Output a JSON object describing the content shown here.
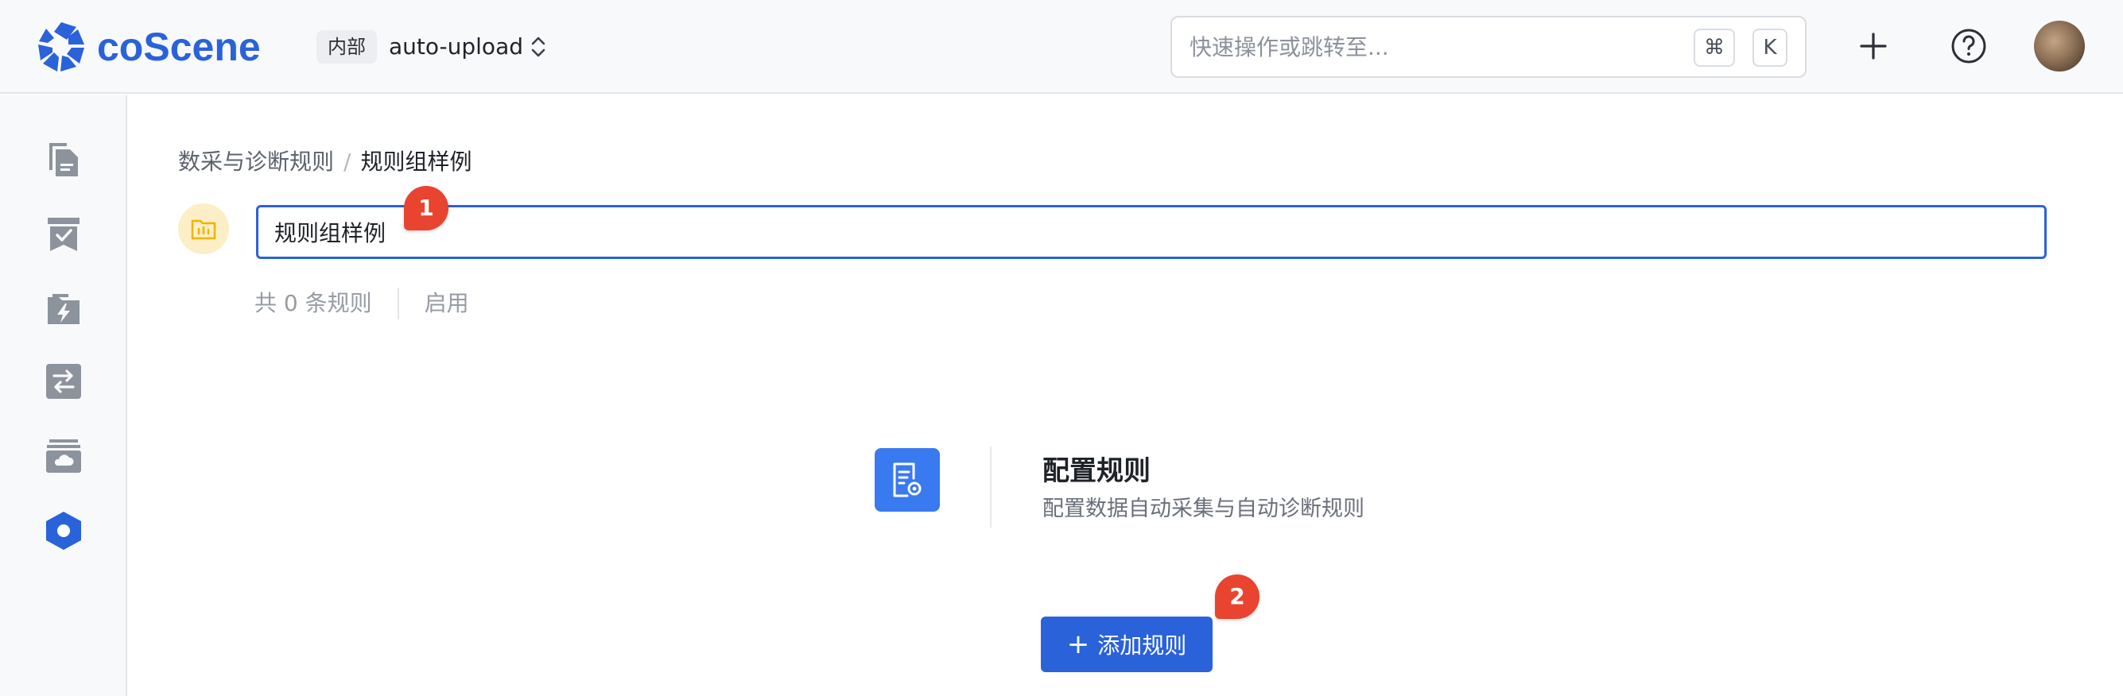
{
  "colors": {
    "brand": "#2a62d9",
    "badge": "#e8442f",
    "folder_bg": "#fcefc8",
    "folder_fg": "#f0b400"
  },
  "header": {
    "logo_text": "coScene",
    "org_badge": "内部",
    "project_name": "auto-upload",
    "search": {
      "placeholder": "快速操作或跳转至...",
      "shortcut_cmd": "⌘",
      "shortcut_key": "K"
    },
    "icons": [
      "plus-icon",
      "help-icon",
      "avatar"
    ]
  },
  "sidebar": {
    "items": [
      {
        "icon": "files-icon"
      },
      {
        "icon": "task-check-icon"
      },
      {
        "icon": "action-bolt-icon"
      },
      {
        "icon": "transfer-icon"
      },
      {
        "icon": "cloud-storage-icon"
      },
      {
        "icon": "rules-hexagon-icon",
        "active": true
      }
    ]
  },
  "breadcrumb": {
    "parent": "数采与诊断规则",
    "separator": "/",
    "current": "规则组样例"
  },
  "rule_group": {
    "name_value": "规则组样例",
    "rule_count_text": "共 0 条规则",
    "status_text": "启用"
  },
  "empty_state": {
    "title": "配置规则",
    "subtitle": "配置数据自动采集与自动诊断规则",
    "add_button_label": "添加规则",
    "add_button_icon": "+"
  },
  "annotations": {
    "badge_1": "1",
    "badge_2": "2"
  }
}
